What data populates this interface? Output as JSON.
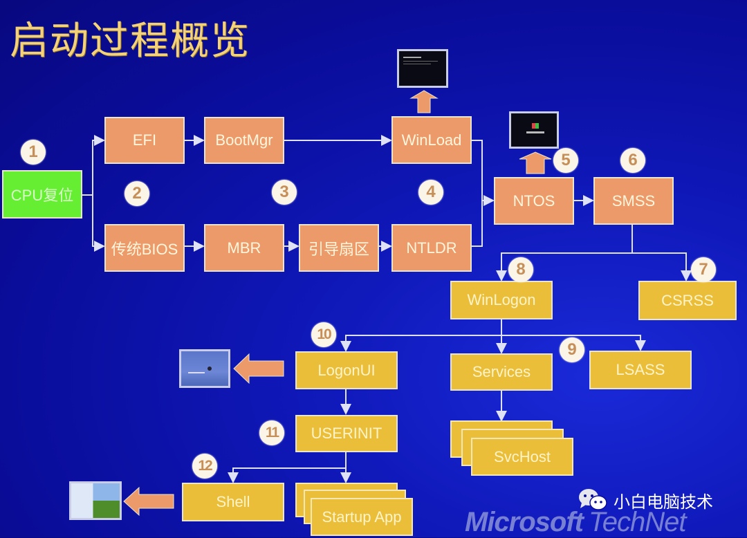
{
  "title": "启动过程概览",
  "nodes": {
    "cpu": "CPU复位",
    "efi": "EFI",
    "bootmgr": "BootMgr",
    "winload": "WinLoad",
    "bios": "传统BIOS",
    "mbr": "MBR",
    "bootsector": "引导扇区",
    "ntldr": "NTLDR",
    "ntos": "NTOS",
    "smss": "SMSS",
    "winlogon": "WinLogon",
    "csrss": "CSRSS",
    "logonui": "LogonUI",
    "services": "Services",
    "lsass": "LSASS",
    "svchost": "SvcHost",
    "userinit": "USERINIT",
    "shell": "Shell",
    "startup": "Startup App"
  },
  "badges": [
    "1",
    "2",
    "3",
    "4",
    "5",
    "6",
    "7",
    "8",
    "9",
    "10",
    "11",
    "12"
  ],
  "screens": {
    "winload": "boot-text-screen",
    "ntos": "windows-splash-screen",
    "logonui": "logon-screen",
    "shell": "desktop-screen"
  },
  "colors": {
    "background": "#0a0d9a",
    "title": "#f4d27a",
    "start_node": "#66ee33",
    "boot_node": "#ec9a6a",
    "process_node": "#ebbe3a",
    "badge": "#fbf5e8",
    "connector": "#dfe2f5"
  },
  "watermark": {
    "brand": "Microsoft",
    "product": "TechNet"
  },
  "wechat": {
    "account": "小白电脑技术"
  }
}
